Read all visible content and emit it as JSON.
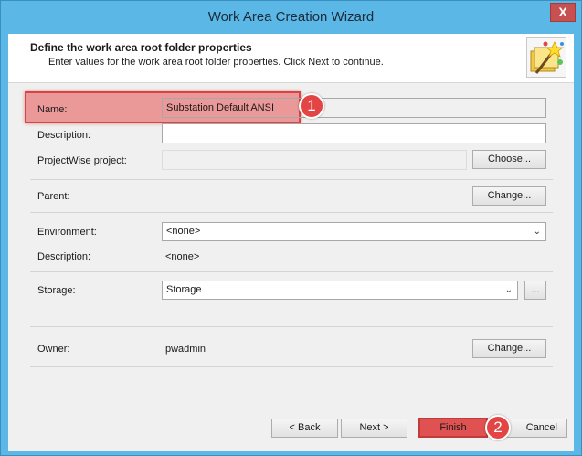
{
  "window": {
    "title": "Work Area Creation Wizard",
    "close_glyph": "X"
  },
  "header": {
    "title": "Define the work area root folder properties",
    "subtitle": "Enter values for the work area root folder properties. Click Next to continue.",
    "icon": "wizard-wand-icon"
  },
  "form": {
    "name_label": "Name:",
    "name_value": "Substation Default ANSI",
    "description_label": "Description:",
    "description_value": "",
    "project_label": "ProjectWise project:",
    "project_value": "",
    "choose_label": "Choose...",
    "parent_label": "Parent:",
    "parent_change_label": "Change...",
    "environment_label": "Environment:",
    "environment_value": "<none>",
    "env_description_label": "Description:",
    "env_description_value": "<none>",
    "storage_label": "Storage:",
    "storage_value": "Storage",
    "storage_browse_label": "...",
    "owner_label": "Owner:",
    "owner_value": "pwadmin",
    "owner_change_label": "Change..."
  },
  "footer": {
    "back_label": "< Back",
    "next_label": "Next >",
    "finish_label": "Finish",
    "cancel_label": "Cancel"
  },
  "annotations": {
    "badge_1": "1",
    "badge_2": "2",
    "highlight_color": "#e34444"
  }
}
